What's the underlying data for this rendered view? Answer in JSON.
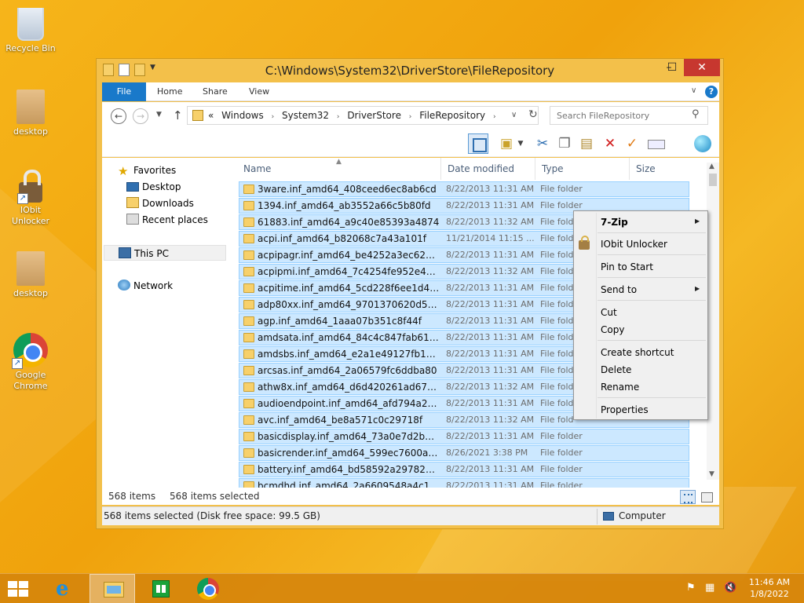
{
  "desktop": {
    "icons": [
      {
        "label": "Recycle Bin"
      },
      {
        "label": "desktop"
      },
      {
        "label": "IObit Unlocker"
      },
      {
        "label": "desktop"
      },
      {
        "label": "Google Chrome"
      }
    ]
  },
  "window": {
    "title": "C:\\Windows\\System32\\DriverStore\\FileRepository",
    "controls": {
      "minimize": "–",
      "maximize": "☐",
      "close": "✕"
    },
    "ribbon_tabs": [
      {
        "label": "File"
      },
      {
        "label": "Home"
      },
      {
        "label": "Share"
      },
      {
        "label": "View"
      }
    ],
    "help_label": "?"
  },
  "address": {
    "prefix": "«",
    "crumbs": [
      "Windows",
      "System32",
      "DriverStore",
      "FileRepository"
    ],
    "separator": "›",
    "search_placeholder": "Search FileRepository"
  },
  "navpane": {
    "favorites": "Favorites",
    "desktop": "Desktop",
    "downloads": "Downloads",
    "recent": "Recent places",
    "this_pc": "This PC",
    "network": "Network"
  },
  "columns": {
    "name": "Name",
    "date": "Date modified",
    "type": "Type",
    "size": "Size"
  },
  "files": [
    {
      "name": "3ware.inf_amd64_408ceed6ec8ab6cd",
      "date": "8/22/2013 11:31 AM",
      "type": "File folder"
    },
    {
      "name": "1394.inf_amd64_ab3552a66c5b80fd",
      "date": "8/22/2013 11:31 AM",
      "type": "File folder"
    },
    {
      "name": "61883.inf_amd64_a9c40e85393a4874",
      "date": "8/22/2013 11:32 AM",
      "type": "File folder"
    },
    {
      "name": "acpi.inf_amd64_b82068c7a43a101f",
      "date": "11/21/2014 11:15 ...",
      "type": "File fold"
    },
    {
      "name": "acpipagr.inf_amd64_be4252a3ec625c86",
      "date": "8/22/2013 11:31 AM",
      "type": "File fold"
    },
    {
      "name": "acpipmi.inf_amd64_7c4254fe952e4964",
      "date": "8/22/2013 11:32 AM",
      "type": "File fold"
    },
    {
      "name": "acpitime.inf_amd64_5cd228f6ee1d44e1",
      "date": "8/22/2013 11:31 AM",
      "type": "File fold"
    },
    {
      "name": "adp80xx.inf_amd64_9701370620d5257f",
      "date": "8/22/2013 11:31 AM",
      "type": "File fold"
    },
    {
      "name": "agp.inf_amd64_1aaa07b351c8f44f",
      "date": "8/22/2013 11:31 AM",
      "type": "File fold"
    },
    {
      "name": "amdsata.inf_amd64_84c4c847fab6120a",
      "date": "8/22/2013 11:31 AM",
      "type": "File fold"
    },
    {
      "name": "amdsbs.inf_amd64_e2a1e49127fb17ef",
      "date": "8/22/2013 11:31 AM",
      "type": "File fold"
    },
    {
      "name": "arcsas.inf_amd64_2a06579fc6ddba80",
      "date": "8/22/2013 11:31 AM",
      "type": "File fold"
    },
    {
      "name": "athw8x.inf_amd64_d6d420261ad679f5",
      "date": "8/22/2013 11:32 AM",
      "type": "File fold"
    },
    {
      "name": "audioendpoint.inf_amd64_afd794a27dab...",
      "date": "8/22/2013 11:31 AM",
      "type": "File fold"
    },
    {
      "name": "avc.inf_amd64_be8a571c0c29718f",
      "date": "8/22/2013 11:32 AM",
      "type": "File fold"
    },
    {
      "name": "basicdisplay.inf_amd64_73a0e7d2b73334c6",
      "date": "8/22/2013 11:31 AM",
      "type": "File folder"
    },
    {
      "name": "basicrender.inf_amd64_599ec7600a215155",
      "date": "8/26/2021 3:38 PM",
      "type": "File folder"
    },
    {
      "name": "battery.inf_amd64_bd58592a297824a4",
      "date": "8/22/2013 11:31 AM",
      "type": "File folder"
    },
    {
      "name": "bcmdhd.inf_amd64_2a6609548a4c11d4",
      "date": "8/22/2013 11:31 AM",
      "type": "File folder"
    }
  ],
  "status": {
    "count": "568 items",
    "selected": "568 items selected",
    "bottom": "568 items selected (Disk free space: 99.5 GB)",
    "location": "Computer"
  },
  "context_menu": {
    "zip": "7-Zip",
    "unlocker": "IObit Unlocker",
    "pin": "Pin to Start",
    "send_to": "Send to",
    "cut": "Cut",
    "copy": "Copy",
    "create_shortcut": "Create shortcut",
    "delete": "Delete",
    "rename": "Rename",
    "properties": "Properties",
    "submenu_arrow": "▶"
  },
  "taskbar": {
    "time": "11:46 AM",
    "date": "1/8/2022",
    "ie_glyph": "e"
  },
  "colors": {
    "selection": "#cce8ff",
    "accent": "#1979ca",
    "close": "#c7372f"
  }
}
